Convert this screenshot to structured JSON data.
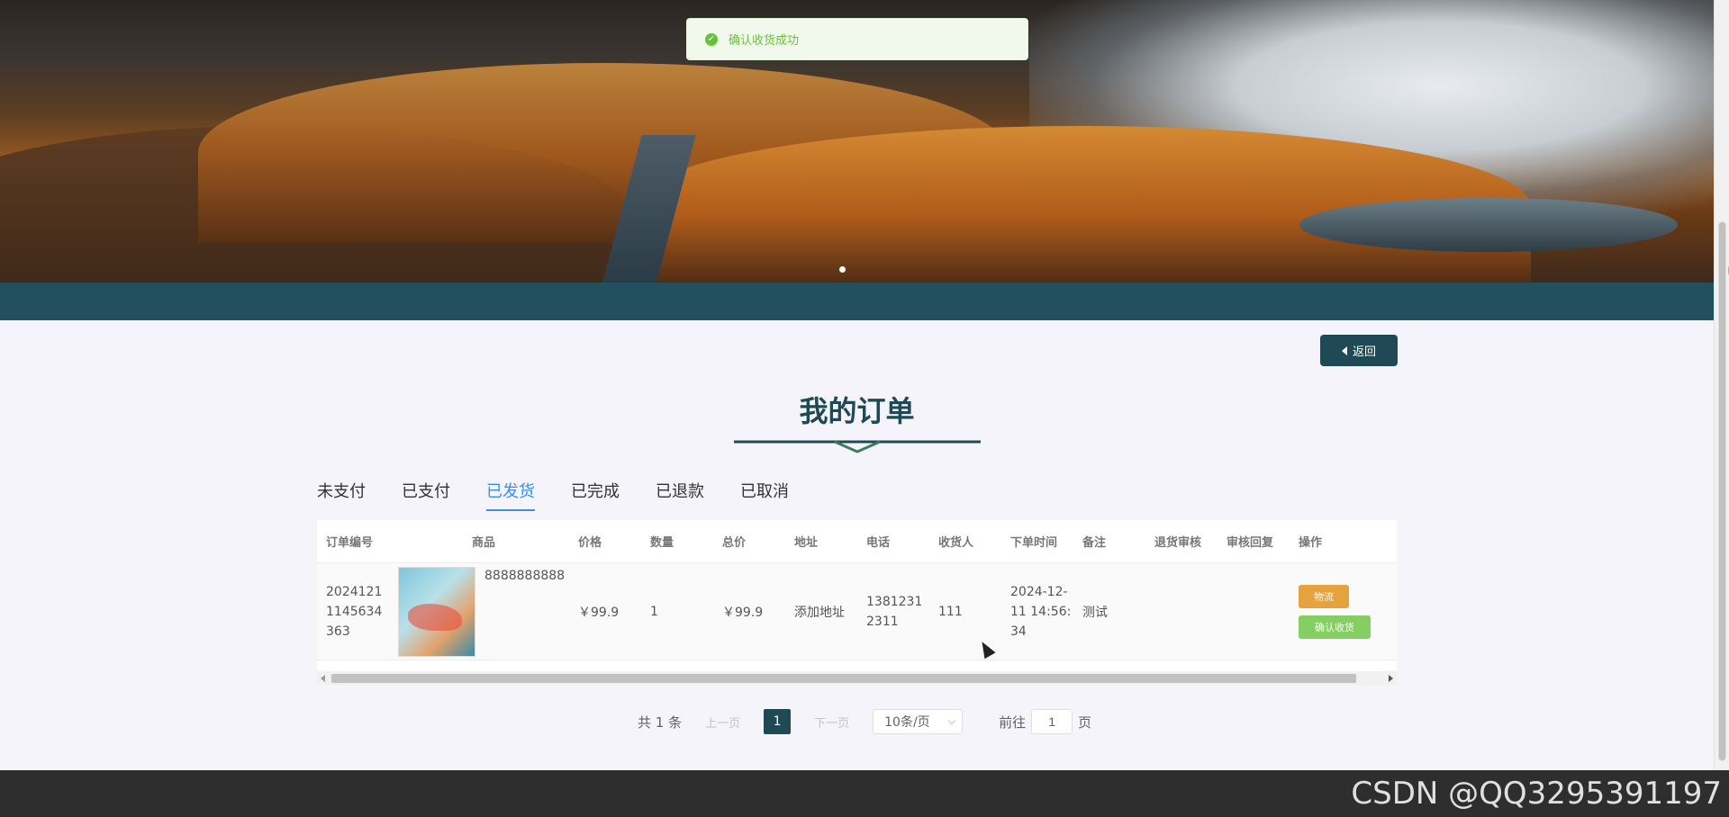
{
  "toast": {
    "message": "确认收货成功",
    "icon": "check-circle-icon"
  },
  "header": {
    "back_label": "返回",
    "back_icon": "caret-left-icon"
  },
  "page": {
    "title": "我的订单"
  },
  "tabs": [
    {
      "label": "未支付",
      "active": false
    },
    {
      "label": "已支付",
      "active": false
    },
    {
      "label": "已发货",
      "active": true
    },
    {
      "label": "已完成",
      "active": false
    },
    {
      "label": "已退款",
      "active": false
    },
    {
      "label": "已取消",
      "active": false
    }
  ],
  "table": {
    "headers": [
      "订单编号",
      "商品",
      "价格",
      "数量",
      "总价",
      "地址",
      "电话",
      "收货人",
      "下单时间",
      "备注",
      "退货审核",
      "审核回复",
      "操作"
    ],
    "rows": [
      {
        "order_no": "20241211145634363",
        "goods_name": "8888888888",
        "price": "￥99.9",
        "quantity": "1",
        "total": "￥99.9",
        "address": "添加地址",
        "phone": "13812312311",
        "receiver": "111",
        "order_time": "2024-12-11 14:56:34",
        "remark": "测试",
        "return_review": "",
        "review_reply": "",
        "actions": {
          "logistics": "物流",
          "confirm": "确认收货"
        }
      }
    ]
  },
  "pagination": {
    "total_text": "共 1 条",
    "prev": "上一页",
    "current_page": "1",
    "next": "下一页",
    "page_size": "10条/页",
    "goto_label": "前往",
    "goto_value": "1",
    "page_suffix": "页"
  },
  "watermark": "CSDN @QQ3295391197",
  "colors": {
    "accent": "#1f4a55",
    "tab_active": "#3a8ee6",
    "success": "#67c23a",
    "warning": "#e6a23c",
    "confirm": "#85ce61"
  }
}
